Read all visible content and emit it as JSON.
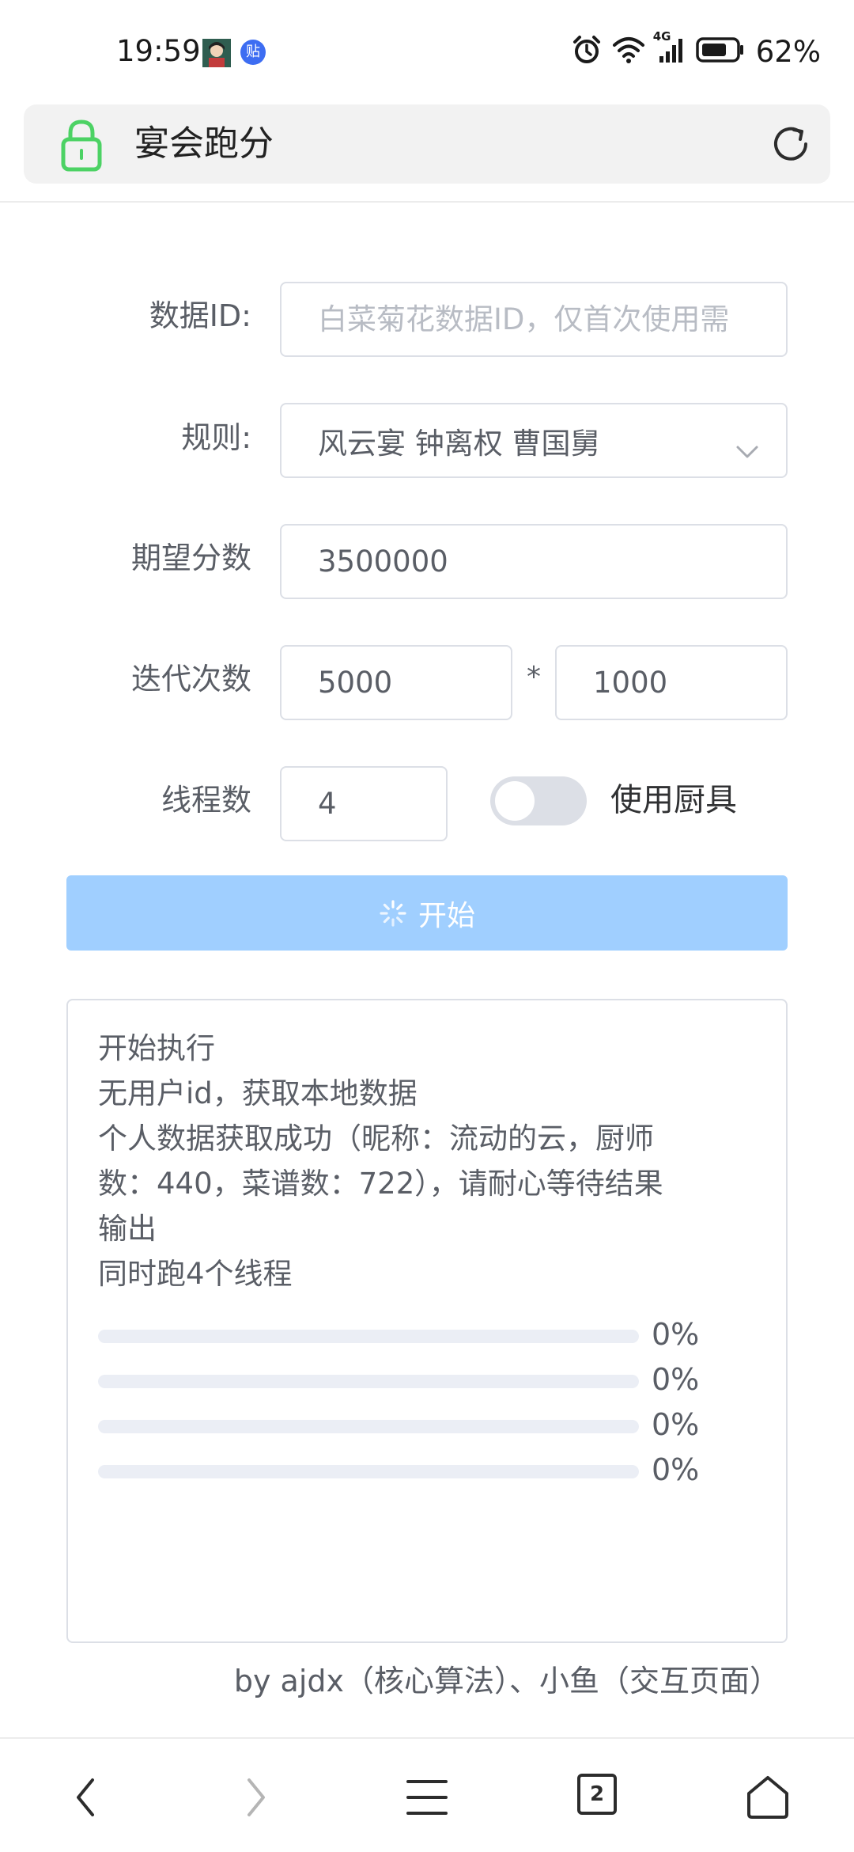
{
  "status_bar": {
    "time": "19:59",
    "notification_badge": "贴",
    "network": "4G",
    "battery": "62%"
  },
  "browser": {
    "page_title": "宴会跑分",
    "tab_count": "2"
  },
  "form": {
    "data_id": {
      "label": "数据ID:",
      "value": "",
      "placeholder": "白菜菊花数据ID，仅首次使用需"
    },
    "rule": {
      "label": "规则:",
      "selected": "风云宴 钟离权 曹国舅"
    },
    "expected_score": {
      "label": "期望分数",
      "value": "3500000"
    },
    "iterations": {
      "label": "迭代次数",
      "value_a": "5000",
      "separator": "*",
      "value_b": "1000"
    },
    "threads": {
      "label": "线程数",
      "value": "4"
    },
    "use_utensils": {
      "label": "使用厨具",
      "enabled": false
    },
    "start_label": "开始"
  },
  "log": {
    "lines": [
      "开始执行",
      "无用户id，获取本地数据",
      "个人数据获取成功（昵称：流动的云，厨师",
      "数：440，菜谱数：722），请耐心等待结果",
      "输出",
      "同时跑4个线程"
    ],
    "progress": [
      {
        "percent": 0,
        "label": "0%"
      },
      {
        "percent": 0,
        "label": "0%"
      },
      {
        "percent": 0,
        "label": "0%"
      },
      {
        "percent": 0,
        "label": "0%"
      }
    ]
  },
  "credits": "by ajdx（核心算法）、小鱼（交互页面）",
  "colors": {
    "primary_disabled": "#a0cfff",
    "border": "#dcdfe6",
    "lock_green": "#4cd264"
  }
}
